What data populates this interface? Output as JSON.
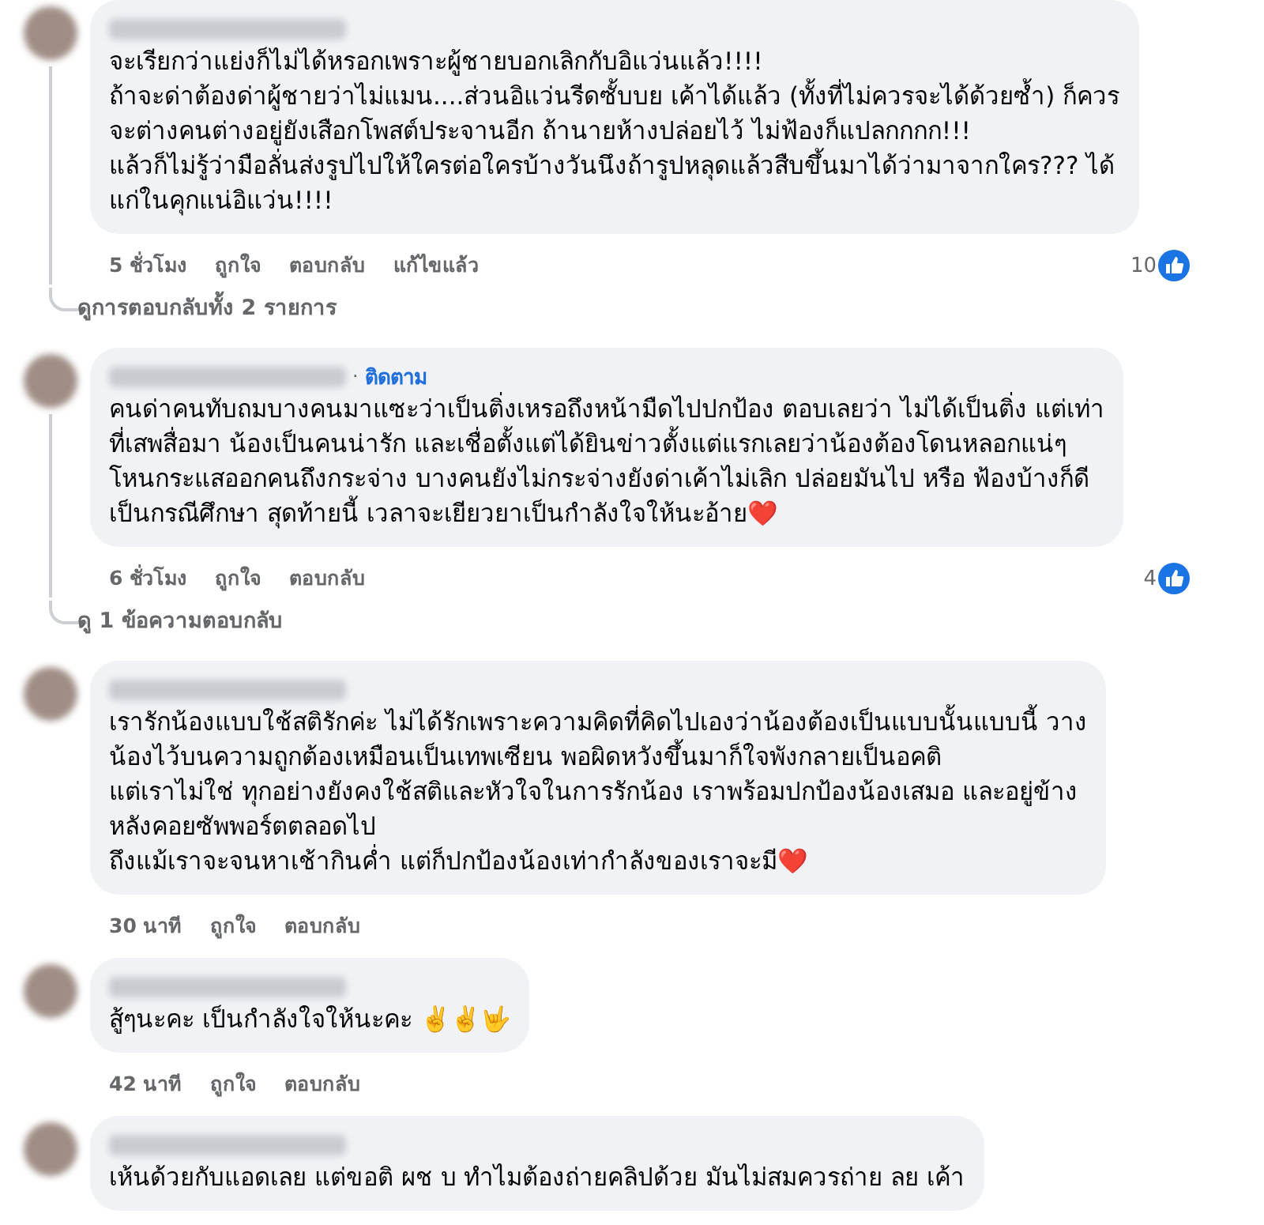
{
  "comments": [
    {
      "text": "จะเรียกว่าแย่งก็ไม่ได้หรอกเพราะผู้ชายบอกเลิกกับอิแว่นแล้ว!!!!\nถ้าจะด่าต้องด่าผู้ชายว่าไม่แมน....ส่วนอิแว่นรีดซั้บบย เค้าได้แล้ว (ทั้งที่ไม่ควรจะได้ด้วยซ้ำ) ก็ควร\nจะต่างคนต่างอยู่ยังเสือกโพสต์ประจานอีก ถ้านายห้างปล่อยไว้ ไม่ฟ้องก็แปลกกกก!!!\nแล้วก็ไม่รู้ว่ามือลั่นส่งรูปไปให้ใครต่อใครบ้างวันนึงถ้ารูปหลุดแล้วสืบขึ้นมาได้ว่ามาจากใคร??? ได้\nแก่ในคุกแน่อิแว่น!!!!",
      "time": "5 ชั่วโมง",
      "actions": [
        "ถูกใจ",
        "ตอบกลับ",
        "แก้ไขแล้ว"
      ],
      "reaction_count": "10",
      "replies_link": "ดูการตอบกลับทั้ง 2 รายการ"
    },
    {
      "separator": "·",
      "follow_label": "ติดตาม",
      "text": "คนด่าคนทับถมบางคนมาแซะว่าเป็นติ่งเหรอถึงหน้ามืดไปปกป้อง ตอบเลยว่า ไม่ได้เป็นติ่ง แต่เท่า\nที่เสพสื่อมา น้องเป็นคนน่ารัก และเชื่อตั้งแต่ได้ยินข่าวตั้งแต่แรกเลยว่าน้องต้องโดนหลอกแน่ๆ\nโหนกระแสออกคนถึงกระจ่าง บางคนยังไม่กระจ่างยังด่าเค้าไม่เลิก ปล่อยมันไป หรือ ฟ้องบ้างก็ดี\nเป็นกรณีศึกษา สุดท้ายนี้ เวลาจะเยียวยาเป็นกำลังใจให้นะอ้าย❤️",
      "time": "6 ชั่วโมง",
      "actions": [
        "ถูกใจ",
        "ตอบกลับ"
      ],
      "reaction_count": "4",
      "replies_link": "ดู 1 ข้อความตอบกลับ"
    },
    {
      "text": "เรารักน้องแบบใช้สติรักค่ะ ไม่ได้รักเพราะความคิดที่คิดไปเองว่าน้องต้องเป็นแบบนั้นแบบนี้ วาง\nน้องไว้บนความถูกต้องเหมือนเป็นเทพเซียน พอผิดหวังขึ้นมาก็ใจพังกลายเป็นอคติ\nแต่เราไม่ใช่ ทุกอย่างยังคงใช้สติและหัวใจในการรักน้อง เราพร้อมปกป้องน้องเสมอ และอยู่ข้าง\nหลังคอยซัพพอร์ตตลอดไป\nถึงแม้เราจะจนหาเช้ากินค่ำ แต่ก็ปกป้องน้องเท่ากำลังของเราจะมี❤️",
      "time": "30 นาที",
      "actions": [
        "ถูกใจ",
        "ตอบกลับ"
      ]
    },
    {
      "text": "สู้ๆนะคะ เป็นกำลังใจให้นะคะ ✌️✌️🤟",
      "time": "42 นาที",
      "actions": [
        "ถูกใจ",
        "ตอบกลับ"
      ]
    },
    {
      "text": "เห้นด้วยกับแอดเลย แต่ขอติ ผช บ ทำไมต้องถ่ายคลิปด้วย มันไม่สมควรถ่าย ลย เค้า"
    }
  ]
}
